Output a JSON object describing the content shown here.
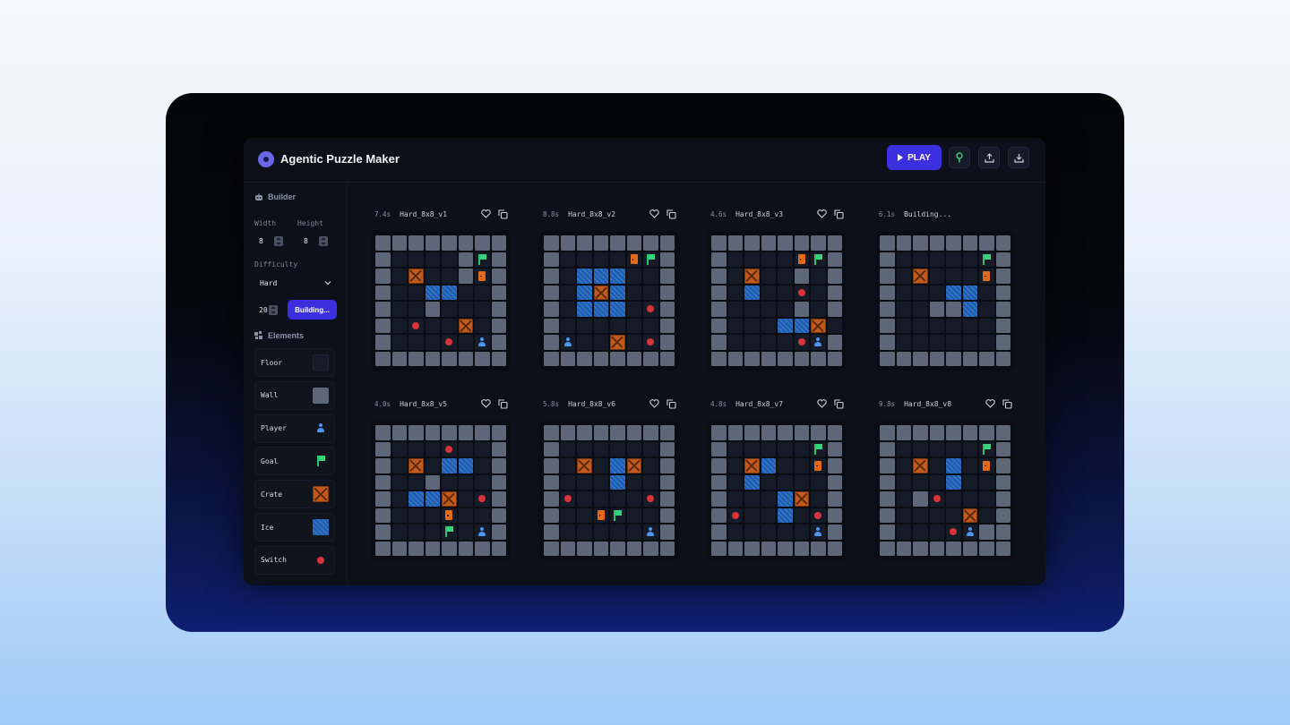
{
  "app": {
    "title": "Agentic Puzzle Maker"
  },
  "toolbar": {
    "play_label": "PLAY",
    "icons": [
      "pin-icon",
      "upload-icon",
      "download-icon"
    ]
  },
  "builder": {
    "heading": "Builder",
    "width_label": "Width",
    "height_label": "Height",
    "width_value": "8",
    "height_value": "8",
    "difficulty_label": "Difficulty",
    "difficulty_value": "Hard",
    "count_value": "20",
    "build_label": "Building..."
  },
  "elements": {
    "heading": "Elements",
    "items": [
      {
        "label": "Floor",
        "icon": "floor-swatch"
      },
      {
        "label": "Wall",
        "icon": "wall-swatch"
      },
      {
        "label": "Player",
        "icon": "player-icon"
      },
      {
        "label": "Goal",
        "icon": "flag-icon"
      },
      {
        "label": "Crate",
        "icon": "crate-icon"
      },
      {
        "label": "Ice",
        "icon": "ice-icon"
      },
      {
        "label": "Switch",
        "icon": "switch-dot-icon"
      }
    ]
  },
  "colors": {
    "accent": "#3b2fe0",
    "wall": "#5d6777",
    "floor": "#151c28",
    "ice": "#1c5fb5",
    "crate": "#c25a1e",
    "switch": "#d9343b",
    "goal": "#37d37c",
    "player": "#4d95f0",
    "door": "#e26b1b"
  },
  "legend": {
    "W": "wall",
    ".": "floor",
    "I": "ice",
    "C": "crate",
    "S": "switch",
    "D": "door",
    "G": "goal",
    "P": "player"
  },
  "puzzles": [
    {
      "time": "7.4s",
      "name": "Hard_8x8_v1",
      "rows": [
        "WWWWWWWW",
        "W....WGW",
        "W.C..WDW",
        "W..II..W",
        "W..W...W",
        "W.S..C.W",
        "W...S.PW",
        "WWWWWWWW"
      ]
    },
    {
      "time": "8.8s",
      "name": "Hard_8x8_v2",
      "rows": [
        "WWWWWWWW",
        "W....DGW",
        "W.III..W",
        "W.ICI..W",
        "W.III.SW",
        "W......W",
        "WP..C.SW",
        "WWWWWWWW"
      ]
    },
    {
      "time": "4.6s",
      "name": "Hard_8x8_v3",
      "rows": [
        "WWWWWWWW",
        "W....DGW",
        "W.C..W.W",
        "W.I..S.W",
        "W....W.W",
        "W...IIC.",
        "W....SPW",
        "WWWWWWWW"
      ]
    },
    {
      "time": "6.1s",
      "name": "Building...",
      "rows": [
        "WWWWWWWW",
        "W.....GW",
        "W.C...DW",
        "W...II.W",
        "W..WWI.W",
        "W......W",
        "W......W",
        "WWWWWWWW"
      ]
    },
    {
      "time": "4.0s",
      "name": "Hard_8x8_v5",
      "rows": [
        "WWWWWWWW",
        "W...S..W",
        "W.C.II.W",
        "W..W...W",
        "W.IIC.SW",
        "W...D..W",
        "W...G.PW",
        "WWWWWWWW"
      ]
    },
    {
      "time": "5.8s",
      "name": "Hard_8x8_v6",
      "rows": [
        "WWWWWWWW",
        "W......W",
        "W.C.IC.W",
        "W...I..W",
        "WS....SW",
        "W..DG..W",
        "W.....PW",
        "WWWWWWWW"
      ]
    },
    {
      "time": "4.8s",
      "name": "Hard_8x8_v7",
      "rows": [
        "WWWWWWWW",
        "W.....GW",
        "W.CI..DW",
        "W.I....W",
        "W...IC.W",
        "WS..I.SW",
        "W.....PW",
        "WWWWWWWW"
      ]
    },
    {
      "time": "9.8s",
      "name": "Hard_8x8_v8",
      "rows": [
        "WWWWWWWW",
        "W.....GW",
        "W.C.I.DW",
        "W...I..W",
        "W.WS...W",
        "W....C.W",
        "W...SPWW",
        "WWWWWWWW"
      ]
    }
  ]
}
